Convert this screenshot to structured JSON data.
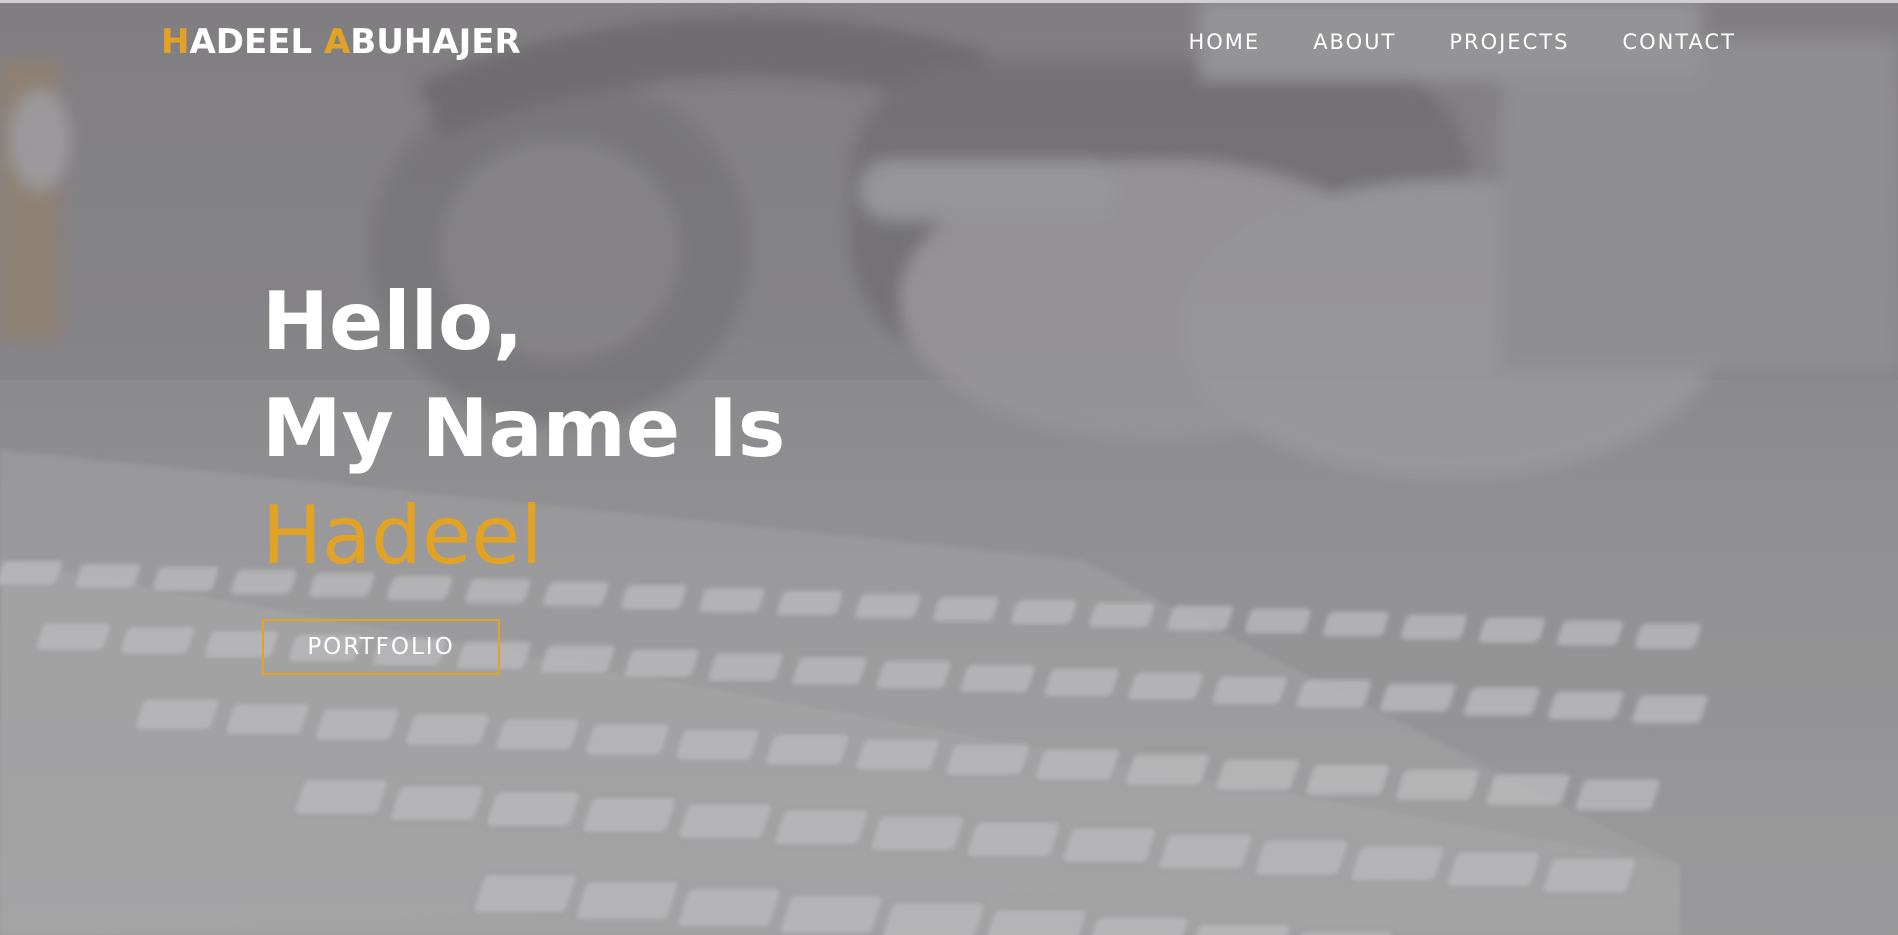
{
  "nav": {
    "logo_first_initial": "H",
    "logo_first_rest": "ADEEL",
    "logo_last_initial": "A",
    "logo_last_rest": "BUHAJER",
    "links": [
      {
        "label": "HOME"
      },
      {
        "label": "ABOUT"
      },
      {
        "label": "PROJECTS"
      },
      {
        "label": "CONTACT"
      }
    ]
  },
  "hero": {
    "line1": "Hello,",
    "line2": "My Name Is",
    "name": "Hadeel",
    "button_label": "PORTFOLIO"
  },
  "colors": {
    "accent": "#e2a325",
    "text": "#ffffff"
  }
}
